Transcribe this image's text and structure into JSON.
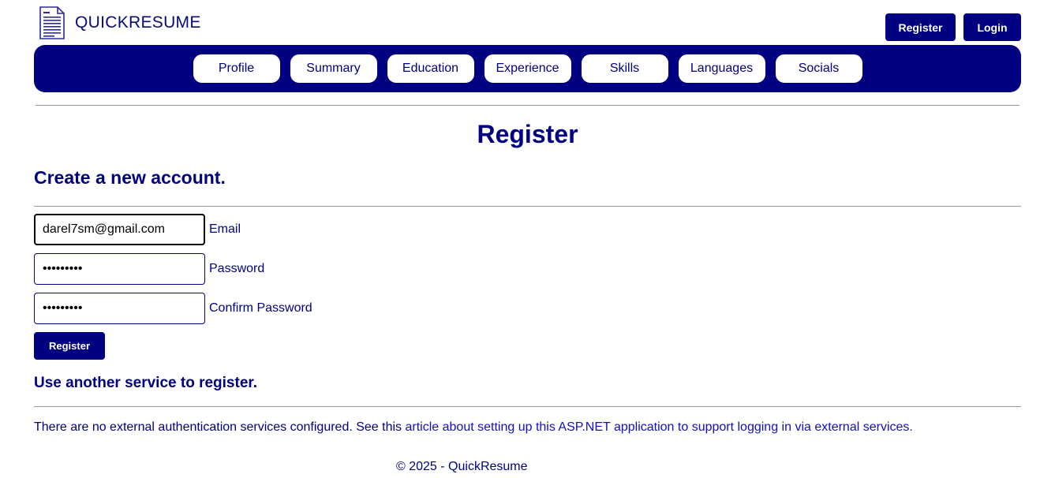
{
  "brand": {
    "name": "QUICKRESUME"
  },
  "header": {
    "register_label": "Register",
    "login_label": "Login"
  },
  "nav": {
    "items": [
      "Profile",
      "Summary",
      "Education",
      "Experience",
      "Skills",
      "Languages",
      "Socials"
    ]
  },
  "page": {
    "title": "Register",
    "subtitle": "Create a new account."
  },
  "form": {
    "email": {
      "value": "darel7sm@gmail.com",
      "label": "Email"
    },
    "password": {
      "value": "•••••••••",
      "label": "Password"
    },
    "confirm_password": {
      "value": "•••••••••",
      "label": "Confirm Password"
    },
    "submit_label": "Register"
  },
  "external": {
    "heading": "Use another service to register.",
    "text_before": "There are no external authentication services configured. See this ",
    "link_text": "article about setting up this ASP.NET application to support logging in via external services",
    "text_after": "."
  },
  "footer": {
    "text": "© 2025 - QuickResume"
  },
  "colors": {
    "primary": "#000080",
    "link": "#1010c0",
    "background": "#ffffff"
  }
}
